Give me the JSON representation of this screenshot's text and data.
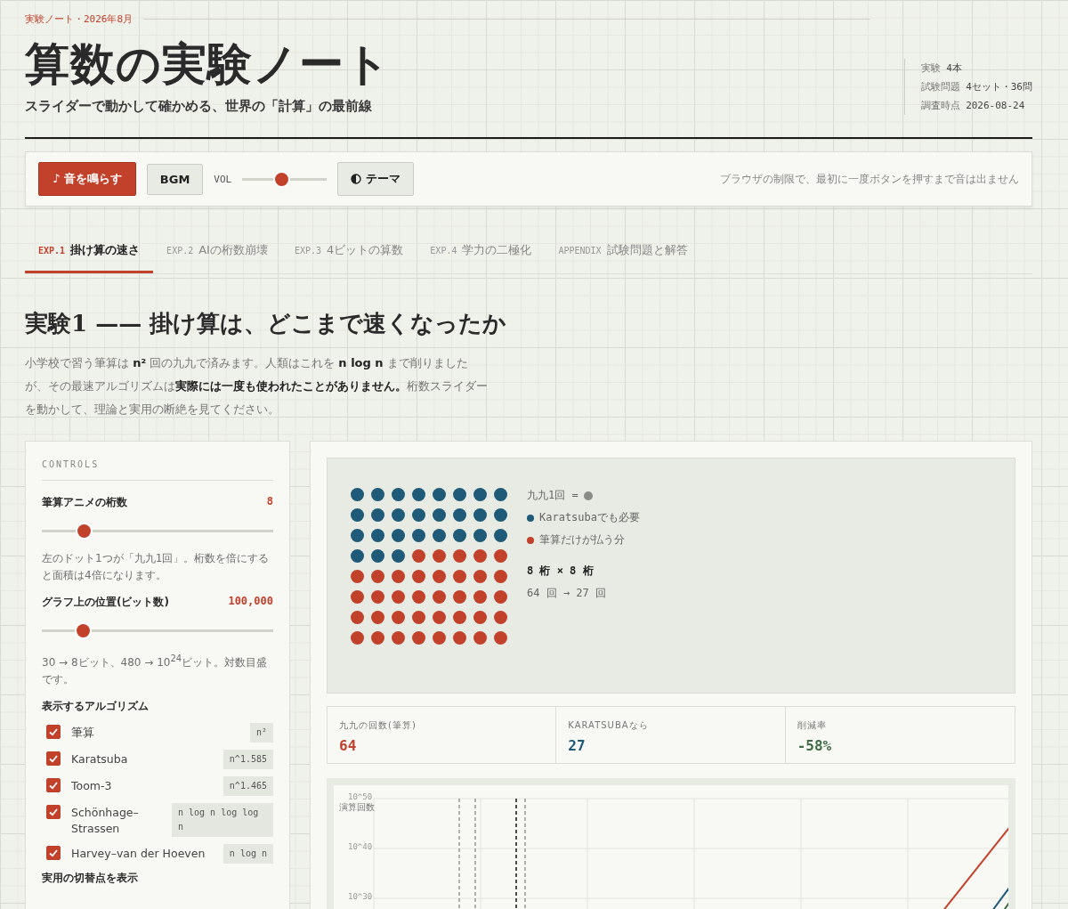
{
  "header": {
    "kicker": "実験ノート・2026年8月",
    "title": "算数の実験ノート",
    "subtitle": "スライダーで動かして確かめる、世界の「計算」の最前線",
    "meta": [
      {
        "label": "実験",
        "value": "4本"
      },
      {
        "label": "試験問題",
        "value": "4セット・36問"
      },
      {
        "label": "調査時点",
        "value": "2026-08-24"
      }
    ]
  },
  "toolbar": {
    "sound_button": "♪ 音を鳴らす",
    "bgm_button": "BGM",
    "volume_label": "VOL",
    "volume": {
      "level": 0.46
    },
    "theme_button": "テーマ",
    "notice": "ブラウザの制限で、最初に一度ボタンを押すまで音は出ません"
  },
  "tabs": [
    {
      "code": "EXP.1",
      "label": "掛け算の速さ",
      "selected": true
    },
    {
      "code": "EXP.2",
      "label": "AIの桁数崩壊",
      "selected": false
    },
    {
      "code": "EXP.3",
      "label": "4ビットの算数",
      "selected": false
    },
    {
      "code": "EXP.4",
      "label": "学力の二極化",
      "selected": false
    },
    {
      "code": "APPENDIX",
      "label": "試験問題と解答",
      "selected": false
    }
  ],
  "section": {
    "heading": "実験1 —— 掛け算は、どこまで速くなったか",
    "intro": "小学校で習う筆算は **n²** 回の九九で済みます。人類はこれを **n log n** まで削りましたが、その最速アルゴリズムは**実際には一度も使われたことがありません。**桁数スライダーを動かして、理論と実用の断絶を見てください。"
  },
  "controls": {
    "title": "CONTROLS",
    "sliders": [
      {
        "label": "筆算アニメの桁数",
        "value": "8",
        "level": 0.18,
        "note": "左のドット1つが「九九1回」。桁数を倍にすると面積は4倍になります。"
      },
      {
        "label": "グラフ上の位置(ビット数)",
        "value": "100,000",
        "level": 0.175,
        "note": "30 → 8ビット、480 → 10$^{24}$ビット。対数目盛です。"
      }
    ],
    "algorithms_title": "表示するアルゴリズム",
    "algorithms": [
      {
        "name": "筆算",
        "complexity": "n²",
        "checked": true
      },
      {
        "name": "Karatsuba",
        "complexity": "n^1.585",
        "checked": true
      },
      {
        "name": "Toom-3",
        "complexity": "n^1.465",
        "checked": true
      },
      {
        "name": "Schönhage–Strassen",
        "complexity": "n log n log log n",
        "checked": true
      },
      {
        "name": "Harvey–van der Hoeven",
        "complexity": "n log n",
        "checked": true
      }
    ],
    "crossover_title": "実用の切替点を表示"
  },
  "dots": {
    "rows": [
      [
        {
          "kind": "K"
        },
        {
          "kind": "K"
        },
        {
          "kind": "K"
        },
        {
          "kind": "K"
        },
        {
          "kind": "K"
        },
        {
          "kind": "K"
        },
        {
          "kind": "K"
        },
        {
          "kind": "K"
        }
      ],
      [
        {
          "kind": "K"
        },
        {
          "kind": "K"
        },
        {
          "kind": "K"
        },
        {
          "kind": "K"
        },
        {
          "kind": "K"
        },
        {
          "kind": "K"
        },
        {
          "kind": "K"
        },
        {
          "kind": "K"
        }
      ],
      [
        {
          "kind": "K"
        },
        {
          "kind": "K"
        },
        {
          "kind": "K"
        },
        {
          "kind": "K"
        },
        {
          "kind": "K"
        },
        {
          "kind": "K"
        },
        {
          "kind": "K"
        },
        {
          "kind": "K"
        }
      ],
      [
        {
          "kind": "K"
        },
        {
          "kind": "K"
        },
        {
          "kind": "K"
        },
        {
          "kind": "S"
        },
        {
          "kind": "S"
        },
        {
          "kind": "S"
        },
        {
          "kind": "S"
        },
        {
          "kind": "S"
        }
      ],
      [
        {
          "kind": "S"
        },
        {
          "kind": "S"
        },
        {
          "kind": "S"
        },
        {
          "kind": "S"
        },
        {
          "kind": "S"
        },
        {
          "kind": "S"
        },
        {
          "kind": "S"
        },
        {
          "kind": "S"
        }
      ],
      [
        {
          "kind": "S"
        },
        {
          "kind": "S"
        },
        {
          "kind": "S"
        },
        {
          "kind": "S"
        },
        {
          "kind": "S"
        },
        {
          "kind": "S"
        },
        {
          "kind": "S"
        },
        {
          "kind": "S"
        }
      ],
      [
        {
          "kind": "S"
        },
        {
          "kind": "S"
        },
        {
          "kind": "S"
        },
        {
          "kind": "S"
        },
        {
          "kind": "S"
        },
        {
          "kind": "S"
        },
        {
          "kind": "S"
        },
        {
          "kind": "S"
        }
      ],
      [
        {
          "kind": "S"
        },
        {
          "kind": "S"
        },
        {
          "kind": "S"
        },
        {
          "kind": "S"
        },
        {
          "kind": "S"
        },
        {
          "kind": "S"
        },
        {
          "kind": "S"
        },
        {
          "kind": "S"
        }
      ]
    ],
    "legend_unit": "九九1回 =",
    "legend": [
      {
        "kind": "K",
        "label": "Karatsubaでも必要",
        "color": "#1f5a78"
      },
      {
        "kind": "S",
        "label": "筆算だけが払う分",
        "color": "#c2412b"
      }
    ],
    "size": "8 桁 × 8 桁",
    "count": "64 回 → 27 回"
  },
  "stats": [
    {
      "label": "九九の回数(筆算)",
      "value": "64",
      "color": "#c2412b"
    },
    {
      "label": "KARATSUBAなら",
      "value": "27",
      "color": "#1f5a78"
    },
    {
      "label": "削減率",
      "value": "-58%",
      "color": "#3f6b45"
    }
  ],
  "chart": {
    "ylabel": "演算回数",
    "yticks": [
      "10^50",
      "10^40",
      "10^30"
    ]
  }
}
